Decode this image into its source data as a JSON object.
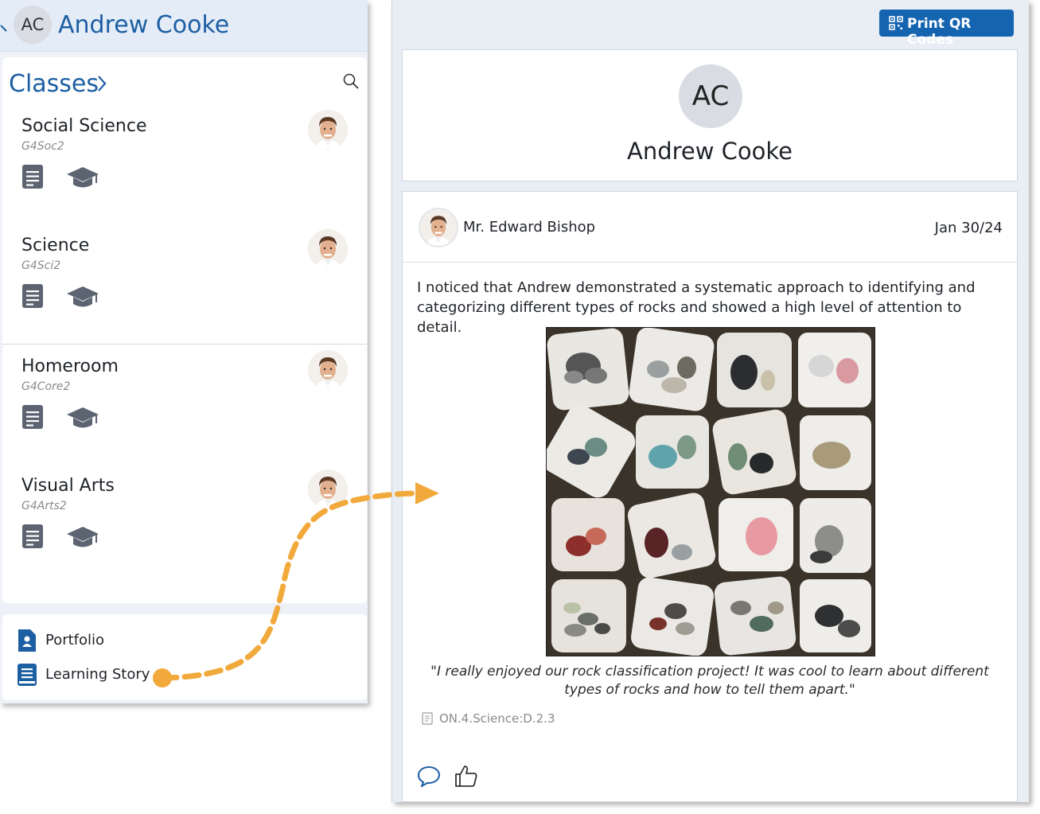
{
  "student": {
    "initials": "AC",
    "name": "Andrew Cooke"
  },
  "classes": {
    "heading": "Classes",
    "items": [
      {
        "name": "Social Science",
        "code": "G4Soc2"
      },
      {
        "name": "Science",
        "code": "G4Sci2"
      },
      {
        "name": "Homeroom",
        "code": "G4Core2"
      },
      {
        "name": "Visual Arts",
        "code": "G4Arts2"
      }
    ]
  },
  "bottom_nav": {
    "portfolio": "Portfolio",
    "learning_story": "Learning Story"
  },
  "toolbar": {
    "print_qr": "Print QR Codes"
  },
  "profile": {
    "initials": "AC",
    "name": "Andrew Cooke"
  },
  "story": {
    "author": "Mr. Edward Bishop",
    "date": "Jan 30/24",
    "text": "I noticed that Andrew demonstrated a systematic approach to identifying and categorizing different types of rocks and showed a high level of attention to detail.",
    "quote": "\"I really enjoyed our rock classification project! It was cool to learn about different types of rocks and how to tell them apart.\"",
    "standard": "ON.4.Science:D.2.3"
  },
  "colors": {
    "accent": "#1d5fa3",
    "button": "#1464b0",
    "arrow": "#f2a93b"
  },
  "icons": [
    "search-icon",
    "chevron-right-icon",
    "document-icon",
    "graduation-cap-icon",
    "portfolio-icon",
    "book-icon",
    "qr-code-icon",
    "comment-icon",
    "thumbs-up-icon"
  ]
}
